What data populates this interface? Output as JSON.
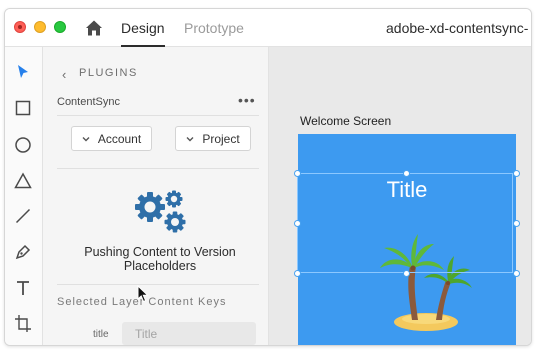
{
  "window": {
    "home_icon": "home-icon",
    "tabs": [
      {
        "label": "Design",
        "active": true
      },
      {
        "label": "Prototype",
        "active": false
      }
    ],
    "document_title": "adobe-xd-contentsync-"
  },
  "toolbar": {
    "tools": [
      "select-arrow-icon",
      "rectangle-icon",
      "ellipse-icon",
      "triangle-icon",
      "line-icon",
      "pen-icon",
      "text-icon",
      "artboard-icon"
    ]
  },
  "panel": {
    "back_glyph": "‹",
    "section_title": "PLUGINS",
    "plugin_name": "ContentSync",
    "more_glyph": "•••",
    "account_button": "Account",
    "project_button": "Project",
    "status_text": "Pushing Content to Version Placeholders",
    "selected_layer_label": "Selected Layer Content Keys",
    "field": {
      "label": "title",
      "placeholder": "Title"
    }
  },
  "canvas": {
    "artboard_name": "Welcome Screen",
    "artboard_title": "Title",
    "accent": "#3d9af0"
  }
}
